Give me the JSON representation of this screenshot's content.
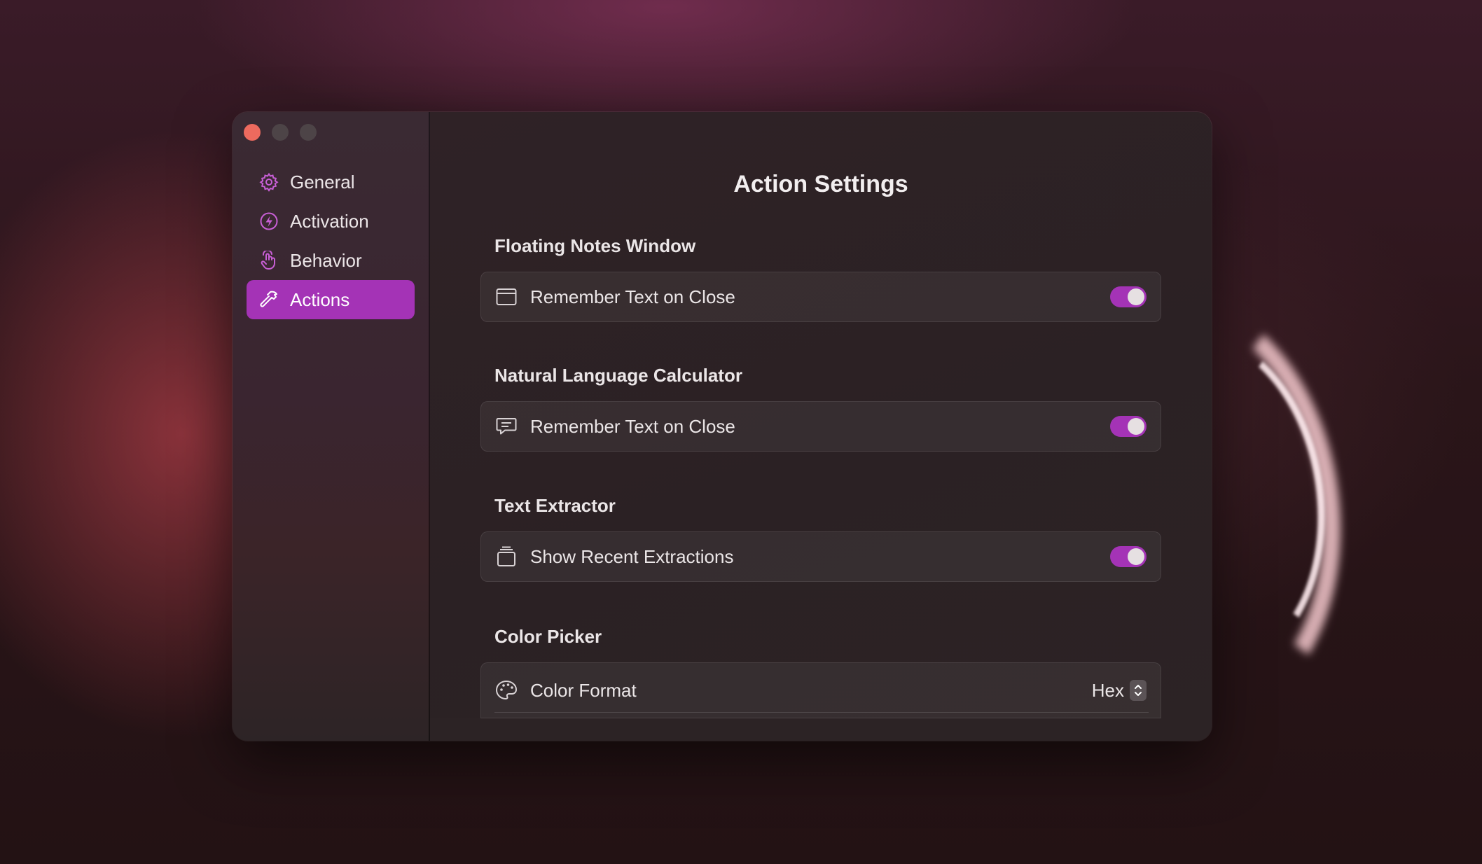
{
  "window": {
    "title": "Action Settings"
  },
  "sidebar": {
    "items": [
      {
        "label": "General",
        "icon": "gear-icon",
        "active": false
      },
      {
        "label": "Activation",
        "icon": "bolt-icon",
        "active": false
      },
      {
        "label": "Behavior",
        "icon": "hand-pointer-icon",
        "active": false
      },
      {
        "label": "Actions",
        "icon": "hammer-icon",
        "active": true
      }
    ]
  },
  "sections": [
    {
      "label": "Floating Notes Window",
      "row": {
        "label": "Remember Text on Close",
        "icon": "window-icon",
        "control": "toggle",
        "value": true
      }
    },
    {
      "label": "Natural Language Calculator",
      "row": {
        "label": "Remember Text on Close",
        "icon": "message-icon",
        "control": "toggle",
        "value": true
      }
    },
    {
      "label": "Text Extractor",
      "row": {
        "label": "Show Recent Extractions",
        "icon": "stack-icon",
        "control": "toggle",
        "value": true
      }
    },
    {
      "label": "Color Picker",
      "row": {
        "label": "Color Format",
        "icon": "palette-icon",
        "control": "select",
        "value": "Hex"
      }
    }
  ],
  "colors": {
    "accent": "#a433b6",
    "close": "#ed6a5e"
  }
}
